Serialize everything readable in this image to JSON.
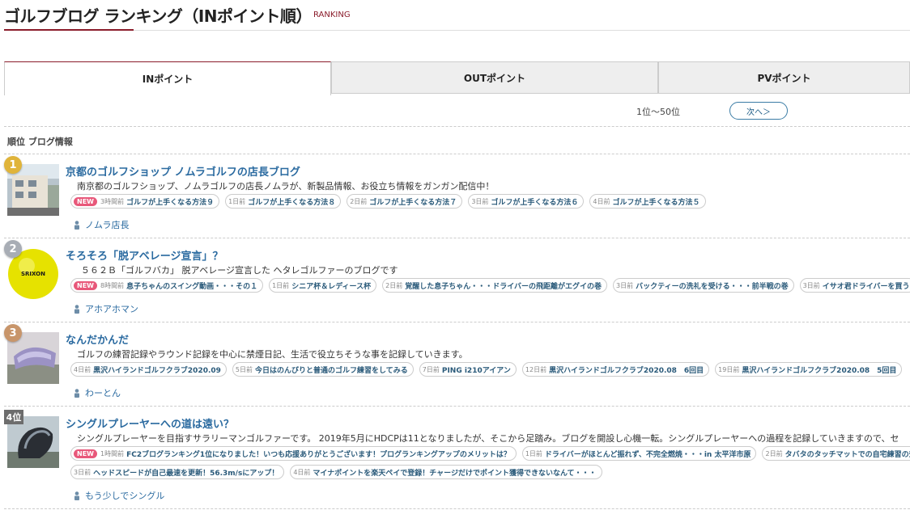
{
  "header": {
    "title": "ゴルフブログ ランキング（INポイント順）",
    "subtitle": "RANKING"
  },
  "tabs": [
    {
      "label": "INポイント"
    },
    {
      "label": "OUTポイント"
    },
    {
      "label": "PVポイント"
    }
  ],
  "pager": {
    "range": "1位〜50位",
    "next_label": "次へ＞"
  },
  "columns": {
    "label": "順位 ブログ情報"
  },
  "entries": [
    {
      "rank": "1",
      "title": "京都のゴルフショップ ノムラゴルフの店長ブログ",
      "description": "南京都のゴルフショップ、ノムラゴルフの店長ノムラが、新製品情報、お役立ち情報をガンガン配信中！",
      "author": "ノムラ店長",
      "posts": [
        {
          "new": true,
          "ago": "3時間前",
          "title": "ゴルフが上手くなる方法９"
        },
        {
          "ago": "1日前",
          "title": "ゴルフが上手くなる方法８"
        },
        {
          "ago": "2日前",
          "title": "ゴルフが上手くなる方法７"
        },
        {
          "ago": "3日前",
          "title": "ゴルフが上手くなる方法６"
        },
        {
          "ago": "4日前",
          "title": "ゴルフが上手くなる方法５"
        }
      ]
    },
    {
      "rank": "2",
      "title": "そろそろ「脱アベレージ宣言」？",
      "description": "５６２Ｂ「ゴルフバカ」 脱アベレージ宣言した ヘタレゴルファーのブログです",
      "author": "アホアホマン",
      "thumb_text": "SRIXON",
      "posts": [
        {
          "new": true,
          "ago": "8時間前",
          "title": "息子ちゃんのスイング動画・・・その１"
        },
        {
          "ago": "1日前",
          "title": "シニア杯＆レディース杯"
        },
        {
          "ago": "2日前",
          "title": "覚醒した息子ちゃん・・・ドライバーの飛距離がエグイの巻"
        },
        {
          "ago": "3日前",
          "title": "バックティーの洗礼を受ける・・・前半戦の巻"
        },
        {
          "ago": "3日前",
          "title": "イサオ君ドライバーを買う"
        }
      ]
    },
    {
      "rank": "3",
      "title": "なんだかんだ",
      "description": "ゴルフの練習記録やラウンド記録を中心に禁煙日記、生活で役立ちそうな事を記録していきます。",
      "author": "わーとん",
      "posts": [
        {
          "ago": "4日前",
          "title": "黒沢ハイランドゴルフクラブ2020.09"
        },
        {
          "ago": "5日前",
          "title": "今日はのんびりと普通のゴルフ練習をしてみる"
        },
        {
          "ago": "7日前",
          "title": "PING i210アイアン"
        },
        {
          "ago": "12日前",
          "title": "黒沢ハイランドゴルフクラブ2020.08　6回目"
        },
        {
          "ago": "19日前",
          "title": "黒沢ハイランドゴルフクラブ2020.08　5回目"
        }
      ]
    },
    {
      "rank": "4位",
      "title": "シングルプレーヤーへの道は遠い？",
      "description": "シングルプレーヤーを目指すサラリーマンゴルファーです。 2019年5月にHDCPは11となりましたが、そこから足踏み。ブログを開設し心機一転。シングルプレーヤーへの過程を記録していきますので、セ",
      "author": "もう少しでシングル",
      "posts": [
        {
          "new": true,
          "ago": "1時間前",
          "title": "FC2ブログランキング1位になりました！いつも応援ありがとうございます！プログランキングアップのメリットは？"
        },
        {
          "ago": "1日前",
          "title": "ドライバーがほとんど振れず、不完全燃焼・・・in 太平洋市原"
        },
        {
          "ago": "2日前",
          "title": "タバタのタッチマットでの自宅練習の効果"
        }
      ],
      "posts2": [
        {
          "ago": "3日前",
          "title": "ヘッドスピードが自己最速を更新！56.3m/sにアップ！"
        },
        {
          "ago": "4日前",
          "title": "マイナポイントを楽天ペイで登録！チャージだけでポイント獲得できないなんて・・・"
        }
      ]
    }
  ],
  "colors": {
    "accent": "#8a1c2b",
    "link": "#2a6aa0",
    "new_badge": "#e8587a"
  }
}
